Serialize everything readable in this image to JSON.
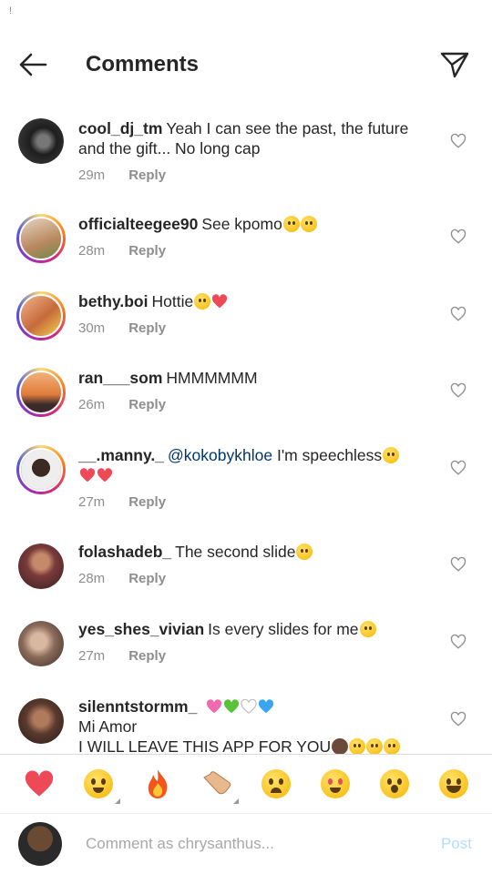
{
  "status": {
    "mark": "!"
  },
  "header": {
    "title": "Comments",
    "back_icon": "arrow-left-icon",
    "send_icon": "paper-plane-icon"
  },
  "comments": [
    {
      "user": "cool_dj_tm",
      "text": "Yeah I can see the past,  the future and the gift... No long cap",
      "time": "29m",
      "reply": "Reply",
      "avatar_color": "#2b2b2b"
    },
    {
      "user": "officialteegee90",
      "text": "See kpomo",
      "time": "28m",
      "reply": "Reply",
      "avatar_color": "#c9a98a",
      "emojis": [
        "face",
        "face"
      ]
    },
    {
      "user": "bethy.boi",
      "text": "Hottie",
      "time": "30m",
      "reply": "Reply",
      "avatar_color": "#d88a6a",
      "emojis": [
        "face",
        "heart"
      ]
    },
    {
      "user": "ran___som",
      "text": "HMMMMMM",
      "time": "26m",
      "reply": "Reply",
      "avatar_color": "#e79a4c"
    },
    {
      "user": "__.manny._",
      "mention": "@kokobykhloe",
      "text": "I'm speechless",
      "time": "27m",
      "reply": "Reply",
      "avatar_color": "#f1f1f1",
      "emojis": [
        "face",
        "heart",
        "heart"
      ]
    },
    {
      "user": "folashadeb_",
      "text": "The second slide",
      "time": "28m",
      "reply": "Reply",
      "avatar_color": "#7a3b3b",
      "emojis": [
        "face"
      ]
    },
    {
      "user": "yes_shes_vivian",
      "text": "Is every slides for me",
      "time": "27m",
      "reply": "Reply",
      "avatar_color": "#8a6a5a",
      "emojis": [
        "face"
      ]
    },
    {
      "user": "silenntstormm_",
      "line2": "Mi Amor",
      "line3": "I WILL LEAVE THIS APP FOR YOU",
      "time": "",
      "reply": "",
      "avatar_color": "#5a3a2e"
    }
  ],
  "emoji_bar": [
    "red-heart",
    "raising-hands",
    "fire",
    "clapping-hands",
    "crying-face",
    "heart-eyes",
    "surprised-face",
    "tears-of-joy"
  ],
  "composer": {
    "placeholder": "Comment as chrysanthus...",
    "post_label": "Post"
  },
  "colors": {
    "accent": "#0095f6",
    "post_disabled": "#b2dffc",
    "heart": "#ed4956",
    "mention": "#00376b"
  }
}
